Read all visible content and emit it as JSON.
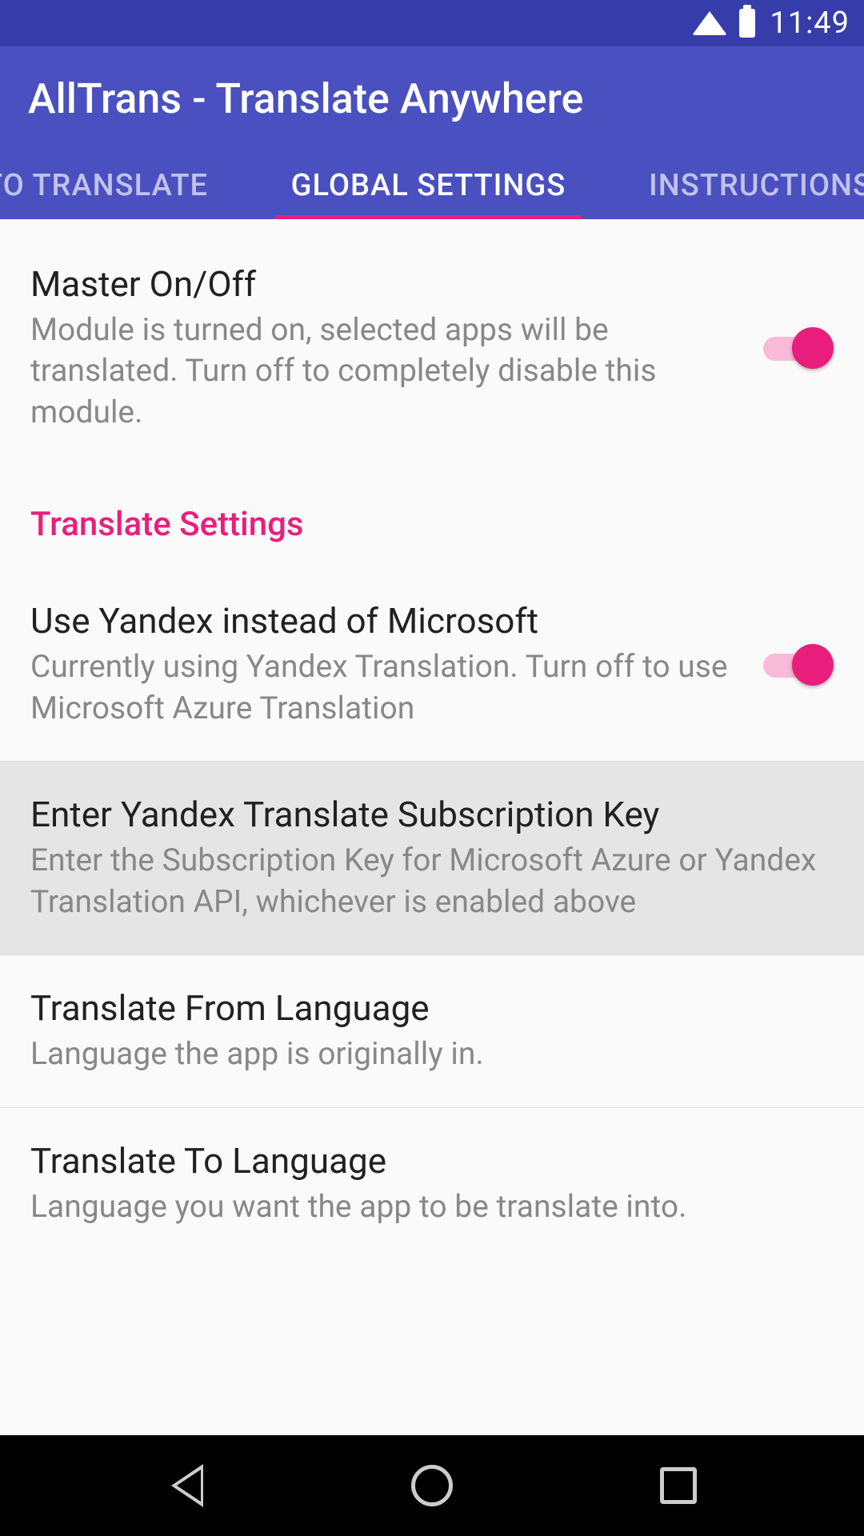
{
  "status_bar": {
    "time": "11:49"
  },
  "app_bar": {
    "title": "AllTrans - Translate Anywhere"
  },
  "tabs": {
    "left": "TO TRANSLATE",
    "center": "GLOBAL SETTINGS",
    "right": "INSTRUCTIONS"
  },
  "settings": {
    "master": {
      "title": "Master On/Off",
      "subtitle": "Module is turned on, selected apps will be translated. Turn off to completely disable this module."
    },
    "section_header": "Translate Settings",
    "yandex": {
      "title": "Use Yandex instead of Microsoft",
      "subtitle": "Currently using Yandex Translation. Turn off to use Microsoft Azure Translation"
    },
    "subscription_key": {
      "title": "Enter Yandex Translate Subscription Key",
      "subtitle": "Enter the Subscription Key for Microsoft Azure or Yandex Translation API, whichever is enabled above"
    },
    "translate_from": {
      "title": "Translate From Language",
      "subtitle": "Language the app is originally in."
    },
    "translate_to": {
      "title": "Translate To Language",
      "subtitle": "Language you want the app to be translate into."
    }
  }
}
